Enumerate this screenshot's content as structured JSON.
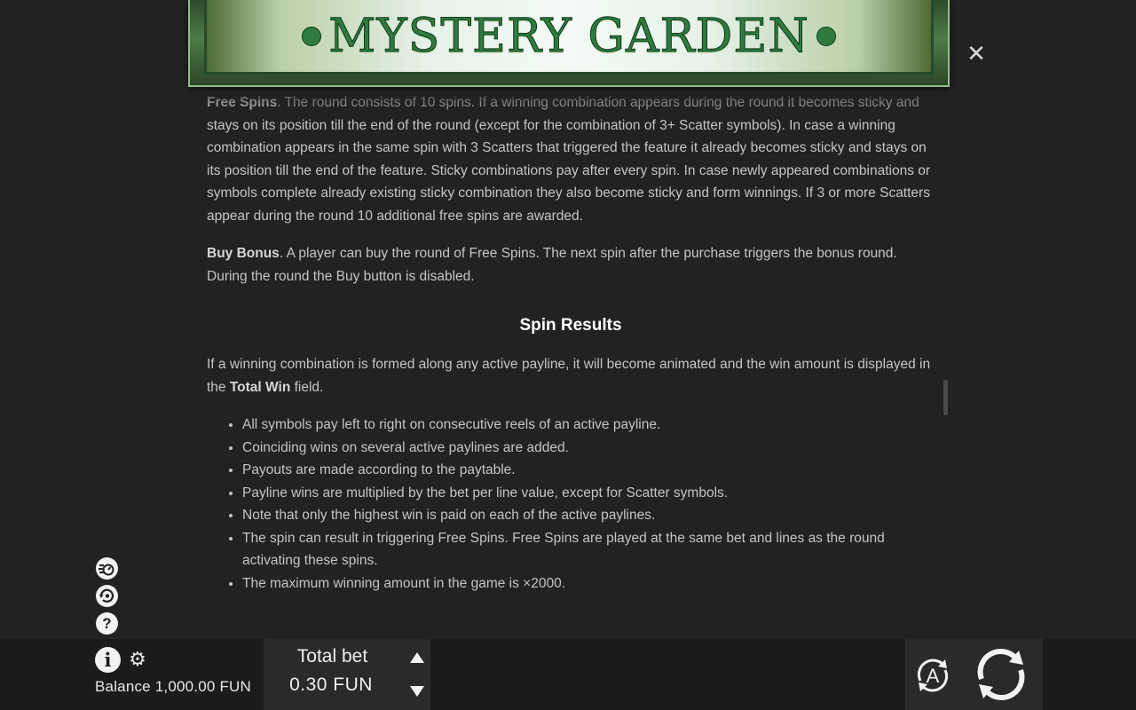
{
  "header": {
    "game_title": "MYSTERY GARDEN",
    "close_icon": "close-icon"
  },
  "rules": {
    "free_spins": {
      "term": "Free Spins",
      "text": ". The round consists of 10 spins. If a winning combination appears during the round it becomes sticky and stays on its position till the end of the round (except for the combination of 3+ Scatter symbols). In case a winning combination appears in the same spin with 3 Scatters that triggered the feature it already becomes sticky and stays on its position till the end of the feature. Sticky combinations pay after every spin. In case newly appeared combinations or symbols complete already existing sticky combination they also become sticky and form winnings. If 3 or more Scatters appear during the round 10 additional free spins are awarded."
    },
    "buy_bonus": {
      "term": "Buy Bonus",
      "text": ". A player can buy the round of Free Spins. The next spin after the purchase triggers the bonus round. During the round the Buy button is disabled."
    },
    "spin_results": {
      "heading": "Spin Results",
      "intro_before": "If a winning combination is formed along any active payline, it will become animated and the win amount is displayed in the ",
      "intro_bold": "Total Win",
      "intro_after": " field.",
      "bullets": [
        "All symbols pay left to right on consecutive reels of an active payline.",
        "Coinciding wins on several active paylines are added.",
        "Payouts are made according to the paytable.",
        "Payline wins are multiplied by the bet per line value, except for Scatter symbols.",
        "Note that only the highest win is paid on each of the active paylines.",
        "The spin can result in triggering Free Spins. Free Spins are played at the same bet and lines as the round activating these spins.",
        "The maximum winning amount in the game is ×2000."
      ]
    }
  },
  "sidebar": {
    "icons": [
      "turbo-icon",
      "history-icon",
      "help-icon"
    ],
    "help_glyph": "?"
  },
  "footer": {
    "info_glyph": "i",
    "balance": "Balance 1,000.00 FUN",
    "bet_label": "Total bet",
    "bet_value": "0.30 FUN",
    "auto_label": "A",
    "icons": [
      "info-icon",
      "gear-icon",
      "arrow-up-icon",
      "arrow-down-icon",
      "autoplay-icon",
      "spin-icon"
    ]
  },
  "colors": {
    "background": "#222222",
    "text": "#c4c4c4",
    "bottom_bar": "#1b1b1b",
    "panel": "#2a2a2a",
    "logo_green": "#2f7a3f"
  }
}
